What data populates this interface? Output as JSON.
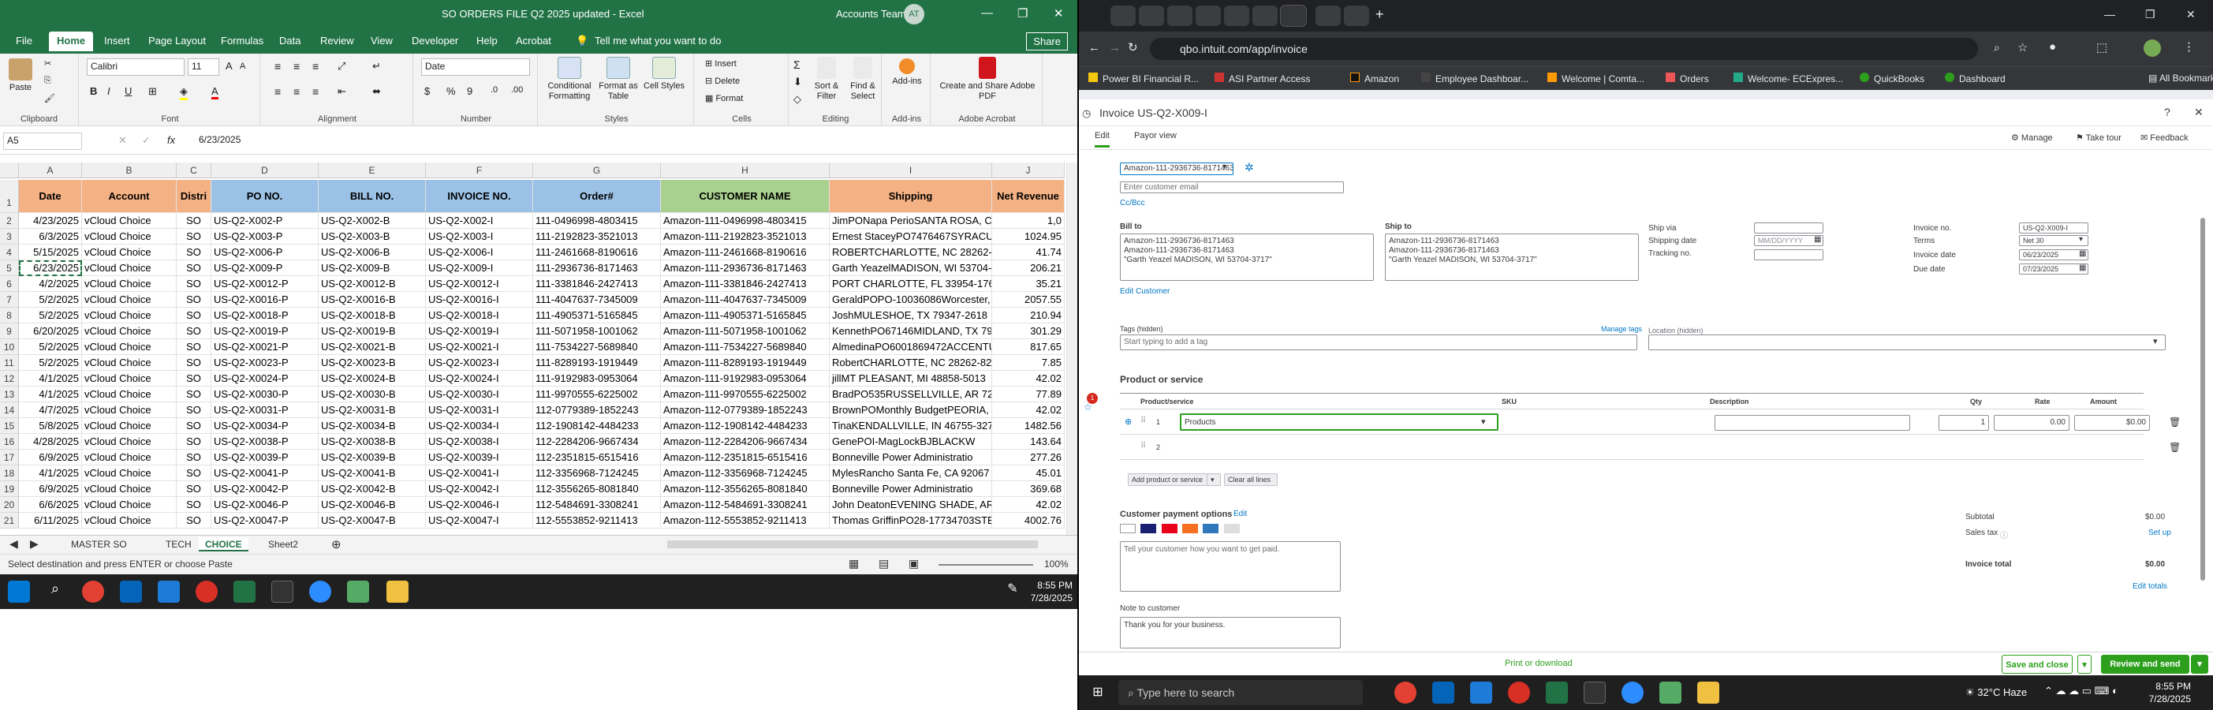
{
  "excel": {
    "window_title": "SO ORDERS FILE Q2 2025 updated  -  Excel",
    "account": "Accounts Team",
    "avatar": "AT",
    "tabs": [
      "File",
      "Home",
      "Insert",
      "Page Layout",
      "Formulas",
      "Data",
      "Review",
      "View",
      "Developer",
      "Help",
      "Acrobat"
    ],
    "tell_me": "Tell me what you want to do",
    "share": "Share",
    "ribbon": {
      "paste": "Paste",
      "clipboard": "Clipboard",
      "font_name": "Calibri",
      "font_size": "11",
      "font_group": "Font",
      "alignment": "Alignment",
      "number_format": "Date",
      "number": "Number",
      "conditional": "Conditional Formatting",
      "format_table": "Format as Table",
      "cell_styles": "Cell Styles",
      "styles": "Styles",
      "insert": "Insert",
      "delete": "Delete",
      "format": "Format",
      "cells": "Cells",
      "sort": "Sort & Filter",
      "find": "Find & Select",
      "editing": "Editing",
      "addins": "Add-ins",
      "addins_group": "Add-ins",
      "create_pdf": "Create and Share Adobe PDF",
      "acrobat_group": "Adobe Acrobat"
    },
    "name_box": "A5",
    "formula": "6/23/2025",
    "columns": [
      "A",
      "B",
      "C",
      "D",
      "E",
      "F",
      "G",
      "H",
      "I",
      "J"
    ],
    "headers": [
      "Date",
      "Account",
      "Distri",
      "PO NO.",
      "BILL NO.",
      "INVOICE NO.",
      "Order#",
      "CUSTOMER NAME",
      "Shipping",
      "Net Revenue"
    ],
    "rows": [
      {
        "n": "2",
        "c": [
          "4/23/2025",
          "vCloud Choice",
          "SO",
          "US-Q2-X002-P",
          "US-Q2-X002-B",
          "US-Q2-X002-I",
          "111-0496998-4803415",
          "Amazon-111-0496998-4803415",
          "JimPONapa PerioSANTA ROSA, CA",
          "1,0"
        ]
      },
      {
        "n": "3",
        "c": [
          "6/3/2025",
          "vCloud Choice",
          "SO",
          "US-Q2-X003-P",
          "US-Q2-X003-B",
          "US-Q2-X003-I",
          "111-2192823-3521013",
          "Amazon-111-2192823-3521013",
          "Ernest StaceyPO7476467SYRACUS",
          "1024.95"
        ]
      },
      {
        "n": "4",
        "c": [
          "5/15/2025",
          "vCloud Choice",
          "SO",
          "US-Q2-X006-P",
          "US-Q2-X006-B",
          "US-Q2-X006-I",
          "111-2461668-8190616",
          "Amazon-111-2461668-8190616",
          "ROBERTCHARLOTTE, NC 28262-138",
          "41.74"
        ]
      },
      {
        "n": "5",
        "c": [
          "6/23/2025",
          "vCloud Choice",
          "SO",
          "US-Q2-X009-P",
          "US-Q2-X009-B",
          "US-Q2-X009-I",
          "111-2936736-8171463",
          "Amazon-111-2936736-8171463",
          "Garth YeazelMADISON, WI 53704-",
          "206.21"
        ]
      },
      {
        "n": "6",
        "c": [
          "4/2/2025",
          "vCloud Choice",
          "SO",
          "US-Q2-X0012-P",
          "US-Q2-X0012-B",
          "US-Q2-X0012-I",
          "111-3381846-2427413",
          "Amazon-111-3381846-2427413",
          "PORT CHARLOTTE, FL 33954-1760",
          "35.21"
        ]
      },
      {
        "n": "7",
        "c": [
          "5/2/2025",
          "vCloud Choice",
          "SO",
          "US-Q2-X0016-P",
          "US-Q2-X0016-B",
          "US-Q2-X0016-I",
          "111-4047637-7345009",
          "Amazon-111-4047637-7345009",
          "GeraldPOPO-10036086Worcester,",
          "2057.55"
        ]
      },
      {
        "n": "8",
        "c": [
          "5/2/2025",
          "vCloud Choice",
          "SO",
          "US-Q2-X0018-P",
          "US-Q2-X0018-B",
          "US-Q2-X0018-I",
          "111-4905371-5165845",
          "Amazon-111-4905371-5165845",
          "JoshMULESHOE, TX 79347-2618",
          "210.94"
        ]
      },
      {
        "n": "9",
        "c": [
          "6/20/2025",
          "vCloud Choice",
          "SO",
          "US-Q2-X0019-P",
          "US-Q2-X0019-B",
          "US-Q2-X0019-I",
          "111-5071958-1001062",
          "Amazon-111-5071958-1001062",
          "KennethPO67146MIDLAND, TX 79",
          "301.29"
        ]
      },
      {
        "n": "10",
        "c": [
          "5/2/2025",
          "vCloud Choice",
          "SO",
          "US-Q2-X0021-P",
          "US-Q2-X0021-B",
          "US-Q2-X0021-I",
          "111-7534227-5689840",
          "Amazon-111-7534227-5689840",
          "AlmedinaPO6001869472ACCENTU",
          "817.65"
        ]
      },
      {
        "n": "11",
        "c": [
          "5/2/2025",
          "vCloud Choice",
          "SO",
          "US-Q2-X0023-P",
          "US-Q2-X0023-B",
          "US-Q2-X0023-I",
          "111-8289193-1919449",
          "Amazon-111-8289193-1919449",
          "RobertCHARLOTTE, NC 28262-822",
          "7.85"
        ]
      },
      {
        "n": "12",
        "c": [
          "4/1/2025",
          "vCloud Choice",
          "SO",
          "US-Q2-X0024-P",
          "US-Q2-X0024-B",
          "US-Q2-X0024-I",
          "111-9192983-0953064",
          "Amazon-111-9192983-0953064",
          "jillMT PLEASANT, MI 48858-5013",
          "42.02"
        ]
      },
      {
        "n": "13",
        "c": [
          "4/1/2025",
          "vCloud Choice",
          "SO",
          "US-Q2-X0030-P",
          "US-Q2-X0030-B",
          "US-Q2-X0030-I",
          "111-9970555-6225002",
          "Amazon-111-9970555-6225002",
          "BradPO535RUSSELLVILLE, AR 7280",
          "77.89"
        ]
      },
      {
        "n": "14",
        "c": [
          "4/7/2025",
          "vCloud Choice",
          "SO",
          "US-Q2-X0031-P",
          "US-Q2-X0031-B",
          "US-Q2-X0031-I",
          "112-0779389-1852243",
          "Amazon-112-0779389-1852243",
          "BrownPOMonthly BudgetPEORIA,",
          "42.02"
        ]
      },
      {
        "n": "15",
        "c": [
          "5/8/2025",
          "vCloud Choice",
          "SO",
          "US-Q2-X0034-P",
          "US-Q2-X0034-B",
          "US-Q2-X0034-I",
          "112-1908142-4484233",
          "Amazon-112-1908142-4484233",
          "TinaKENDALLVILLE, IN 46755-3272",
          "1482.56"
        ]
      },
      {
        "n": "16",
        "c": [
          "4/28/2025",
          "vCloud Choice",
          "SO",
          "US-Q2-X0038-P",
          "US-Q2-X0038-B",
          "US-Q2-X0038-I",
          "112-2284206-9667434",
          "Amazon-112-2284206-9667434",
          "GenePOI-MagLockBJBLACKW",
          "143.64"
        ]
      },
      {
        "n": "17",
        "c": [
          "6/9/2025",
          "vCloud Choice",
          "SO",
          "US-Q2-X0039-P",
          "US-Q2-X0039-B",
          "US-Q2-X0039-I",
          "112-2351815-6515416",
          "Amazon-112-2351815-6515416",
          "Bonneville Power Administratio",
          "277.26"
        ]
      },
      {
        "n": "18",
        "c": [
          "4/1/2025",
          "vCloud Choice",
          "SO",
          "US-Q2-X0041-P",
          "US-Q2-X0041-B",
          "US-Q2-X0041-I",
          "112-3356968-7124245",
          "Amazon-112-3356968-7124245",
          "MylesRancho Santa Fe, CA 92067",
          "45.01"
        ]
      },
      {
        "n": "19",
        "c": [
          "6/9/2025",
          "vCloud Choice",
          "SO",
          "US-Q2-X0042-P",
          "US-Q2-X0042-B",
          "US-Q2-X0042-I",
          "112-3556265-8081840",
          "Amazon-112-3556265-8081840",
          "Bonneville Power Administratio",
          "369.68"
        ]
      },
      {
        "n": "20",
        "c": [
          "6/6/2025",
          "vCloud Choice",
          "SO",
          "US-Q2-X0046-P",
          "US-Q2-X0046-B",
          "US-Q2-X0046-I",
          "112-5484691-3308241",
          "Amazon-112-5484691-3308241",
          "John DeatonEVENING SHADE, AR",
          "42.02"
        ]
      },
      {
        "n": "21",
        "c": [
          "6/11/2025",
          "vCloud Choice",
          "SO",
          "US-Q2-X0047-P",
          "US-Q2-X0047-B",
          "US-Q2-X0047-I",
          "112-5553852-9211413",
          "Amazon-112-5553852-9211413",
          "Thomas GriffinPO28-17734703STE",
          "4002.76"
        ]
      }
    ],
    "sheet_tabs": [
      "MASTER SO",
      "TECH",
      "CHOICE",
      "Sheet2"
    ],
    "status_text": "Select destination and press ENTER or choose Paste",
    "zoom": "100%",
    "clock_time": "8:55 PM",
    "clock_date": "7/28/2025"
  },
  "browser": {
    "url": "qbo.intuit.com/app/invoice",
    "bookmarks": [
      "Power BI Financial R...",
      "ASI Partner Access",
      "Amazon",
      "Employee Dashboar...",
      "Welcome | Comta...",
      "Orders",
      "Welcome- ECExpres...",
      "QuickBooks",
      "Dashboard"
    ],
    "all_bookmarks": "All Bookmarks",
    "invoice": {
      "title": "Invoice US-Q2-X009-I",
      "edit": "Edit",
      "payor_view": "Payor view",
      "manage": "Manage",
      "take_tour": "Take tour",
      "feedback": "Feedback",
      "customer": "Amazon-111-2936736-8171463",
      "email_placeholder": "Enter customer email",
      "cc_bcc": "Cc/Bcc",
      "bill_to_label": "Bill to",
      "bill_to": [
        "Amazon-111-2936736-8171463",
        "Amazon-111-2936736-8171463",
        "\"Garth Yeazel MADISON, WI 53704-3717\""
      ],
      "ship_to_label": "Ship to",
      "ship_to": [
        "Amazon-111-2936736-8171463",
        "Amazon-111-2936736-8171463",
        "\"Garth Yeazel MADISON, WI 53704-3717\""
      ],
      "ship_via": "Ship via",
      "shipping_date": "Shipping date",
      "shipping_date_ph": "MM/DD/YYYY",
      "tracking_no": "Tracking no.",
      "invoice_no_label": "Invoice no.",
      "invoice_no": "US-Q2-X009-I",
      "terms_label": "Terms",
      "terms": "Net 30",
      "invoice_date_label": "Invoice date",
      "invoice_date": "06/23/2025",
      "due_date_label": "Due date",
      "due_date": "07/23/2025",
      "edit_customer": "Edit Customer",
      "tags_label": "Tags (hidden)",
      "manage_tags": "Manage tags",
      "tags_ph": "Start typing to add a tag",
      "location_label": "Location (hidden)",
      "section": "Product or service",
      "cols": {
        "product": "Product/service",
        "sku": "SKU",
        "description": "Description",
        "qty": "Qty",
        "rate": "Rate",
        "amount": "Amount"
      },
      "line1": {
        "num": "1",
        "product": "Products",
        "qty": "1",
        "rate": "0.00",
        "amount": "$0.00"
      },
      "line2": {
        "num": "2"
      },
      "add_product": "Add product or service",
      "clear_lines": "Clear all lines",
      "payment_options": "Customer payment options",
      "payment_edit": "Edit",
      "pay_placeholder": "Tell your customer how you want to get paid.",
      "note_label": "Note to customer",
      "note": "Thank you for your business.",
      "subtotal_label": "Subtotal",
      "subtotal": "$0.00",
      "sales_tax_label": "Sales tax",
      "setup": "Set up",
      "total_label": "Invoice total",
      "total": "$0.00",
      "edit_totals": "Edit totals",
      "print": "Print or download",
      "save_close": "Save and close",
      "review_send": "Review and send"
    },
    "search_placeholder": "Type here to search",
    "weather": "32°C  Haze",
    "clock_time": "8:55 PM",
    "clock_date": "7/28/2025"
  }
}
